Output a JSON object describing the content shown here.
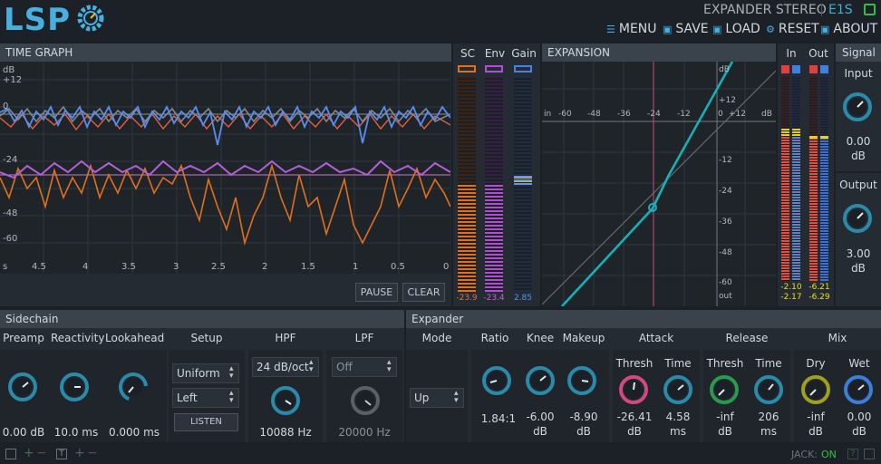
{
  "app": {
    "logo": "LSP",
    "plugin_name": "EXPANDER STEREO",
    "version": "E1S"
  },
  "menu": [
    {
      "icon": "menu-icon",
      "label": "MENU"
    },
    {
      "icon": "save-icon",
      "label": "SAVE"
    },
    {
      "icon": "load-icon",
      "label": "LOAD"
    },
    {
      "icon": "reset-icon",
      "label": "RESET"
    },
    {
      "icon": "info-icon",
      "label": "ABOUT"
    }
  ],
  "time_graph": {
    "title": "TIME GRAPH",
    "db_unit": "dB",
    "db_ticks": [
      "+12",
      "0",
      "-24",
      "-48",
      "-60"
    ],
    "time_ticks": [
      "s",
      "4.5",
      "4",
      "3.5",
      "3",
      "2.5",
      "2",
      "1.5",
      "1",
      "0.5",
      "0"
    ],
    "pause": "PAUSE",
    "clear": "CLEAR"
  },
  "meters": {
    "sc": {
      "label": "SC",
      "value": "-23.9",
      "color": "#e07020"
    },
    "env": {
      "label": "Env",
      "value": "-23.4",
      "color": "#b050d0"
    },
    "gain": {
      "label": "Gain",
      "value": "2.85",
      "color": "#4a80e0"
    }
  },
  "expansion": {
    "title": "EXPANSION",
    "x_ticks": [
      "in",
      "-60",
      "-48",
      "-36",
      "-24",
      "-12",
      "0",
      "+12",
      "dB"
    ],
    "y_ticks": [
      "dB",
      "+12",
      "0",
      "-12",
      "-24",
      "-36",
      "-48",
      "-60",
      "out"
    ]
  },
  "io_meters": {
    "in": {
      "label": "In",
      "left": "-2.10",
      "right": "-2.17"
    },
    "out": {
      "label": "Out",
      "left": "-6.21",
      "right": "-6.29"
    }
  },
  "signal": {
    "title": "Signal",
    "input_label": "Input",
    "input_value": "0.00",
    "input_unit": "dB",
    "output_label": "Output",
    "output_value": "3.00",
    "output_unit": "dB"
  },
  "sidechain": {
    "title": "Sidechain",
    "preamp_label": "Preamp",
    "preamp_value": "0.00 dB",
    "reactivity_label": "Reactivity",
    "reactivity_value": "10.0 ms",
    "lookahead_label": "Lookahead",
    "lookahead_value": "0.000 ms",
    "setup_label": "Setup",
    "setup_type": "Uniform",
    "setup_source": "Left",
    "listen": "LISTEN",
    "hpf_label": "HPF",
    "hpf_slope": "24 dB/oct",
    "hpf_value": "10088 Hz",
    "lpf_label": "LPF",
    "lpf_slope": "Off",
    "lpf_value": "20000 Hz"
  },
  "expander": {
    "title": "Expander",
    "mode_label": "Mode",
    "mode_value": "Up",
    "ratio_label": "Ratio",
    "ratio_value": "1.84:1",
    "knee_label": "Knee",
    "knee_value": "-6.00",
    "knee_unit": "dB",
    "makeup_label": "Makeup",
    "makeup_value": "-8.90",
    "makeup_unit": "dB",
    "attack_label": "Attack",
    "attack_thresh_label": "Thresh",
    "attack_thresh_value": "-26.41",
    "attack_thresh_unit": "dB",
    "attack_time_label": "Time",
    "attack_time_value": "4.58",
    "attack_time_unit": "ms",
    "release_label": "Release",
    "release_thresh_label": "Thresh",
    "release_thresh_value": "-inf",
    "release_thresh_unit": "dB",
    "release_time_label": "Time",
    "release_time_value": "206",
    "release_time_unit": "ms",
    "mix_label": "Mix",
    "dry_label": "Dry",
    "dry_value": "-inf",
    "dry_unit": "dB",
    "wet_label": "Wet",
    "wet_value": "0.00",
    "wet_unit": "dB"
  },
  "status": {
    "jack_label": "JACK:",
    "jack_state": "ON"
  }
}
